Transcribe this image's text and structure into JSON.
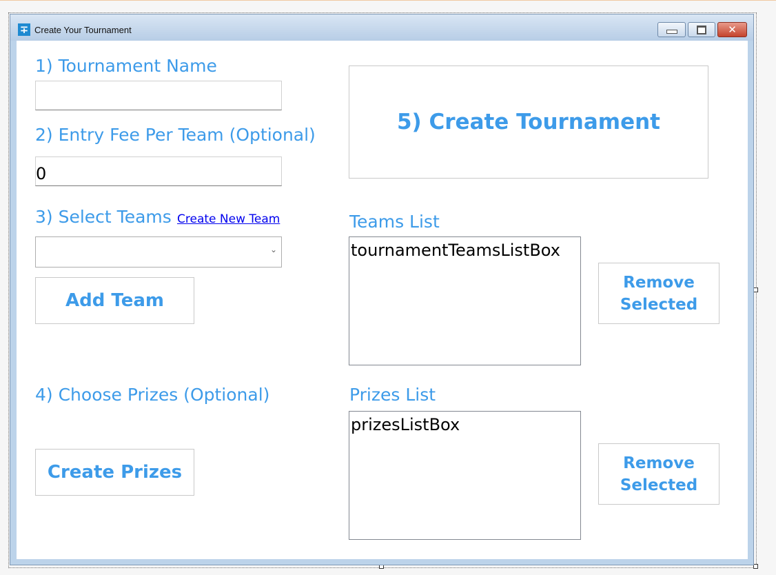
{
  "window": {
    "title": "Create Your Tournament",
    "icon": "tournament-app-icon",
    "controls": {
      "minimize": "minimize-icon",
      "maximize": "maximize-icon",
      "close": "✕"
    }
  },
  "form": {
    "tournament_name": {
      "label": "1) Tournament Name",
      "value": ""
    },
    "entry_fee": {
      "label": "2) Entry Fee Per Team (Optional)",
      "value": "0"
    },
    "select_teams": {
      "label": "3) Select Teams",
      "link": "Create New Team",
      "selected": ""
    },
    "add_team_button": "Add Team",
    "choose_prizes": {
      "label": "4) Choose Prizes (Optional)"
    },
    "create_prizes_button": "Create Prizes",
    "create_tournament_button": "5) Create Tournament",
    "teams_list": {
      "label": "Teams List",
      "items": [
        "tournamentTeamsListBox"
      ]
    },
    "remove_selected_teams_button": "Remove Selected",
    "prizes_list": {
      "label": "Prizes List",
      "items": [
        "prizesListBox"
      ]
    },
    "remove_selected_prizes_button": "Remove Selected"
  },
  "colors": {
    "accent": "#3d9be9",
    "link": "#0000ee"
  }
}
